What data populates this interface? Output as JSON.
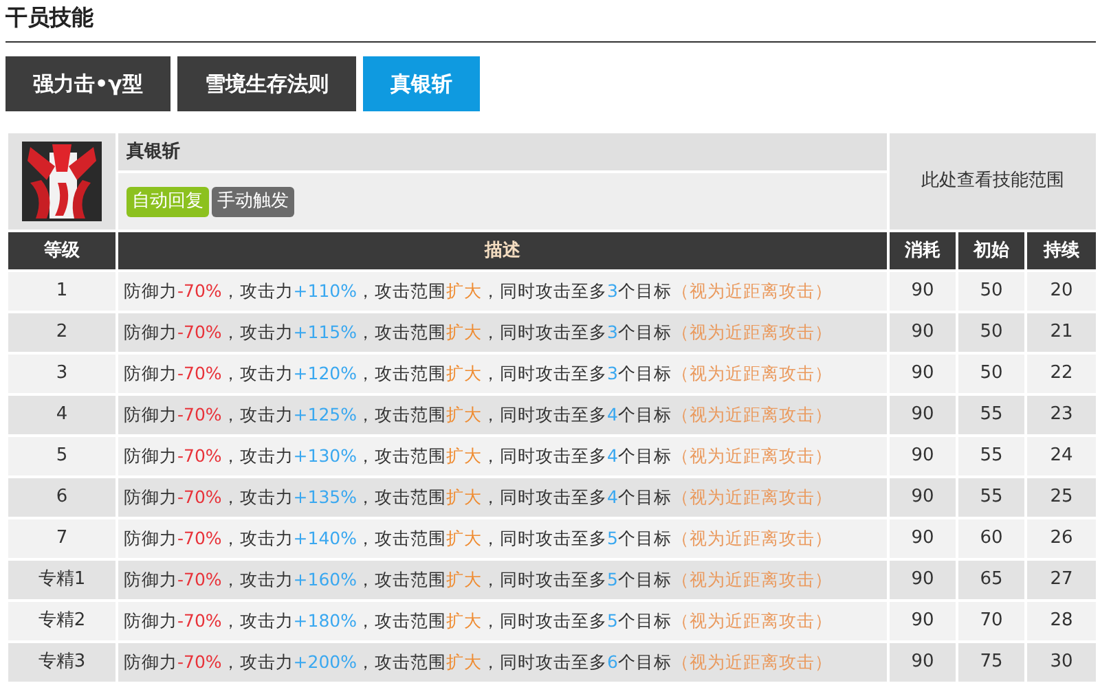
{
  "section_title": "干员技能",
  "tabs": [
    {
      "label": "强力击•γ型",
      "selected": false
    },
    {
      "label": "雪境生存法则",
      "selected": false
    },
    {
      "label": "真银斩",
      "selected": true
    }
  ],
  "skill": {
    "name": "真银斩",
    "tags": [
      {
        "label": "自动回复",
        "color": "#8cc11f"
      },
      {
        "label": "手动触发",
        "color": "#6b6b6b"
      }
    ],
    "range_link": "此处查看技能范围"
  },
  "table": {
    "columns": [
      "等级",
      "描述",
      "消耗",
      "初始",
      "持续"
    ],
    "rows": [
      {
        "level": "1",
        "description": [
          {
            "text": "防御力",
            "color": "#333333"
          },
          {
            "text": "-70%",
            "color": "#e8333a"
          },
          {
            "text": "，攻击力",
            "color": "#333333"
          },
          {
            "text": "+110%",
            "color": "#3aa8f0"
          },
          {
            "text": "，攻击范围",
            "color": "#333333"
          },
          {
            "text": "扩大",
            "color": "#ef8c32"
          },
          {
            "text": "，同时攻击至多",
            "color": "#333333"
          },
          {
            "text": "3",
            "color": "#3aa8f0"
          },
          {
            "text": "个目标",
            "color": "#333333"
          },
          {
            "text": "（视为近距离攻击）",
            "color": "#ea9a5e"
          }
        ],
        "cost": "90",
        "initial": "50",
        "duration": "20"
      },
      {
        "level": "2",
        "description": [
          {
            "text": "防御力",
            "color": "#333333"
          },
          {
            "text": "-70%",
            "color": "#e8333a"
          },
          {
            "text": "，攻击力",
            "color": "#333333"
          },
          {
            "text": "+115%",
            "color": "#3aa8f0"
          },
          {
            "text": "，攻击范围",
            "color": "#333333"
          },
          {
            "text": "扩大",
            "color": "#ef8c32"
          },
          {
            "text": "，同时攻击至多",
            "color": "#333333"
          },
          {
            "text": "3",
            "color": "#3aa8f0"
          },
          {
            "text": "个目标",
            "color": "#333333"
          },
          {
            "text": "（视为近距离攻击）",
            "color": "#ea9a5e"
          }
        ],
        "cost": "90",
        "initial": "50",
        "duration": "21"
      },
      {
        "level": "3",
        "description": [
          {
            "text": "防御力",
            "color": "#333333"
          },
          {
            "text": "-70%",
            "color": "#e8333a"
          },
          {
            "text": "，攻击力",
            "color": "#333333"
          },
          {
            "text": "+120%",
            "color": "#3aa8f0"
          },
          {
            "text": "，攻击范围",
            "color": "#333333"
          },
          {
            "text": "扩大",
            "color": "#ef8c32"
          },
          {
            "text": "，同时攻击至多",
            "color": "#333333"
          },
          {
            "text": "3",
            "color": "#3aa8f0"
          },
          {
            "text": "个目标",
            "color": "#333333"
          },
          {
            "text": "（视为近距离攻击）",
            "color": "#ea9a5e"
          }
        ],
        "cost": "90",
        "initial": "50",
        "duration": "22"
      },
      {
        "level": "4",
        "description": [
          {
            "text": "防御力",
            "color": "#333333"
          },
          {
            "text": "-70%",
            "color": "#e8333a"
          },
          {
            "text": "，攻击力",
            "color": "#333333"
          },
          {
            "text": "+125%",
            "color": "#3aa8f0"
          },
          {
            "text": "，攻击范围",
            "color": "#333333"
          },
          {
            "text": "扩大",
            "color": "#ef8c32"
          },
          {
            "text": "，同时攻击至多",
            "color": "#333333"
          },
          {
            "text": "4",
            "color": "#3aa8f0"
          },
          {
            "text": "个目标",
            "color": "#333333"
          },
          {
            "text": "（视为近距离攻击）",
            "color": "#ea9a5e"
          }
        ],
        "cost": "90",
        "initial": "55",
        "duration": "23"
      },
      {
        "level": "5",
        "description": [
          {
            "text": "防御力",
            "color": "#333333"
          },
          {
            "text": "-70%",
            "color": "#e8333a"
          },
          {
            "text": "，攻击力",
            "color": "#333333"
          },
          {
            "text": "+130%",
            "color": "#3aa8f0"
          },
          {
            "text": "，攻击范围",
            "color": "#333333"
          },
          {
            "text": "扩大",
            "color": "#ef8c32"
          },
          {
            "text": "，同时攻击至多",
            "color": "#333333"
          },
          {
            "text": "4",
            "color": "#3aa8f0"
          },
          {
            "text": "个目标",
            "color": "#333333"
          },
          {
            "text": "（视为近距离攻击）",
            "color": "#ea9a5e"
          }
        ],
        "cost": "90",
        "initial": "55",
        "duration": "24"
      },
      {
        "level": "6",
        "description": [
          {
            "text": "防御力",
            "color": "#333333"
          },
          {
            "text": "-70%",
            "color": "#e8333a"
          },
          {
            "text": "，攻击力",
            "color": "#333333"
          },
          {
            "text": "+135%",
            "color": "#3aa8f0"
          },
          {
            "text": "，攻击范围",
            "color": "#333333"
          },
          {
            "text": "扩大",
            "color": "#ef8c32"
          },
          {
            "text": "，同时攻击至多",
            "color": "#333333"
          },
          {
            "text": "4",
            "color": "#3aa8f0"
          },
          {
            "text": "个目标",
            "color": "#333333"
          },
          {
            "text": "（视为近距离攻击）",
            "color": "#ea9a5e"
          }
        ],
        "cost": "90",
        "initial": "55",
        "duration": "25"
      },
      {
        "level": "7",
        "description": [
          {
            "text": "防御力",
            "color": "#333333"
          },
          {
            "text": "-70%",
            "color": "#e8333a"
          },
          {
            "text": "，攻击力",
            "color": "#333333"
          },
          {
            "text": "+140%",
            "color": "#3aa8f0"
          },
          {
            "text": "，攻击范围",
            "color": "#333333"
          },
          {
            "text": "扩大",
            "color": "#ef8c32"
          },
          {
            "text": "，同时攻击至多",
            "color": "#333333"
          },
          {
            "text": "5",
            "color": "#3aa8f0"
          },
          {
            "text": "个目标",
            "color": "#333333"
          },
          {
            "text": "（视为近距离攻击）",
            "color": "#ea9a5e"
          }
        ],
        "cost": "90",
        "initial": "60",
        "duration": "26"
      },
      {
        "level": "专精1",
        "description": [
          {
            "text": "防御力",
            "color": "#333333"
          },
          {
            "text": "-70%",
            "color": "#e8333a"
          },
          {
            "text": "，攻击力",
            "color": "#333333"
          },
          {
            "text": "+160%",
            "color": "#3aa8f0"
          },
          {
            "text": "，攻击范围",
            "color": "#333333"
          },
          {
            "text": "扩大",
            "color": "#ef8c32"
          },
          {
            "text": "，同时攻击至多",
            "color": "#333333"
          },
          {
            "text": "5",
            "color": "#3aa8f0"
          },
          {
            "text": "个目标",
            "color": "#333333"
          },
          {
            "text": "（视为近距离攻击）",
            "color": "#ea9a5e"
          }
        ],
        "cost": "90",
        "initial": "65",
        "duration": "27"
      },
      {
        "level": "专精2",
        "description": [
          {
            "text": "防御力",
            "color": "#333333"
          },
          {
            "text": "-70%",
            "color": "#e8333a"
          },
          {
            "text": "，攻击力",
            "color": "#333333"
          },
          {
            "text": "+180%",
            "color": "#3aa8f0"
          },
          {
            "text": "，攻击范围",
            "color": "#333333"
          },
          {
            "text": "扩大",
            "color": "#ef8c32"
          },
          {
            "text": "，同时攻击至多",
            "color": "#333333"
          },
          {
            "text": "5",
            "color": "#3aa8f0"
          },
          {
            "text": "个目标",
            "color": "#333333"
          },
          {
            "text": "（视为近距离攻击）",
            "color": "#ea9a5e"
          }
        ],
        "cost": "90",
        "initial": "70",
        "duration": "28"
      },
      {
        "level": "专精3",
        "description": [
          {
            "text": "防御力",
            "color": "#333333"
          },
          {
            "text": "-70%",
            "color": "#e8333a"
          },
          {
            "text": "，攻击力",
            "color": "#333333"
          },
          {
            "text": "+200%",
            "color": "#3aa8f0"
          },
          {
            "text": "，攻击范围",
            "color": "#333333"
          },
          {
            "text": "扩大",
            "color": "#ef8c32"
          },
          {
            "text": "，同时攻击至多",
            "color": "#333333"
          },
          {
            "text": "6",
            "color": "#3aa8f0"
          },
          {
            "text": "个目标",
            "color": "#333333"
          },
          {
            "text": "（视为近距离攻击）",
            "color": "#ea9a5e"
          }
        ],
        "cost": "90",
        "initial": "75",
        "duration": "30"
      }
    ]
  }
}
